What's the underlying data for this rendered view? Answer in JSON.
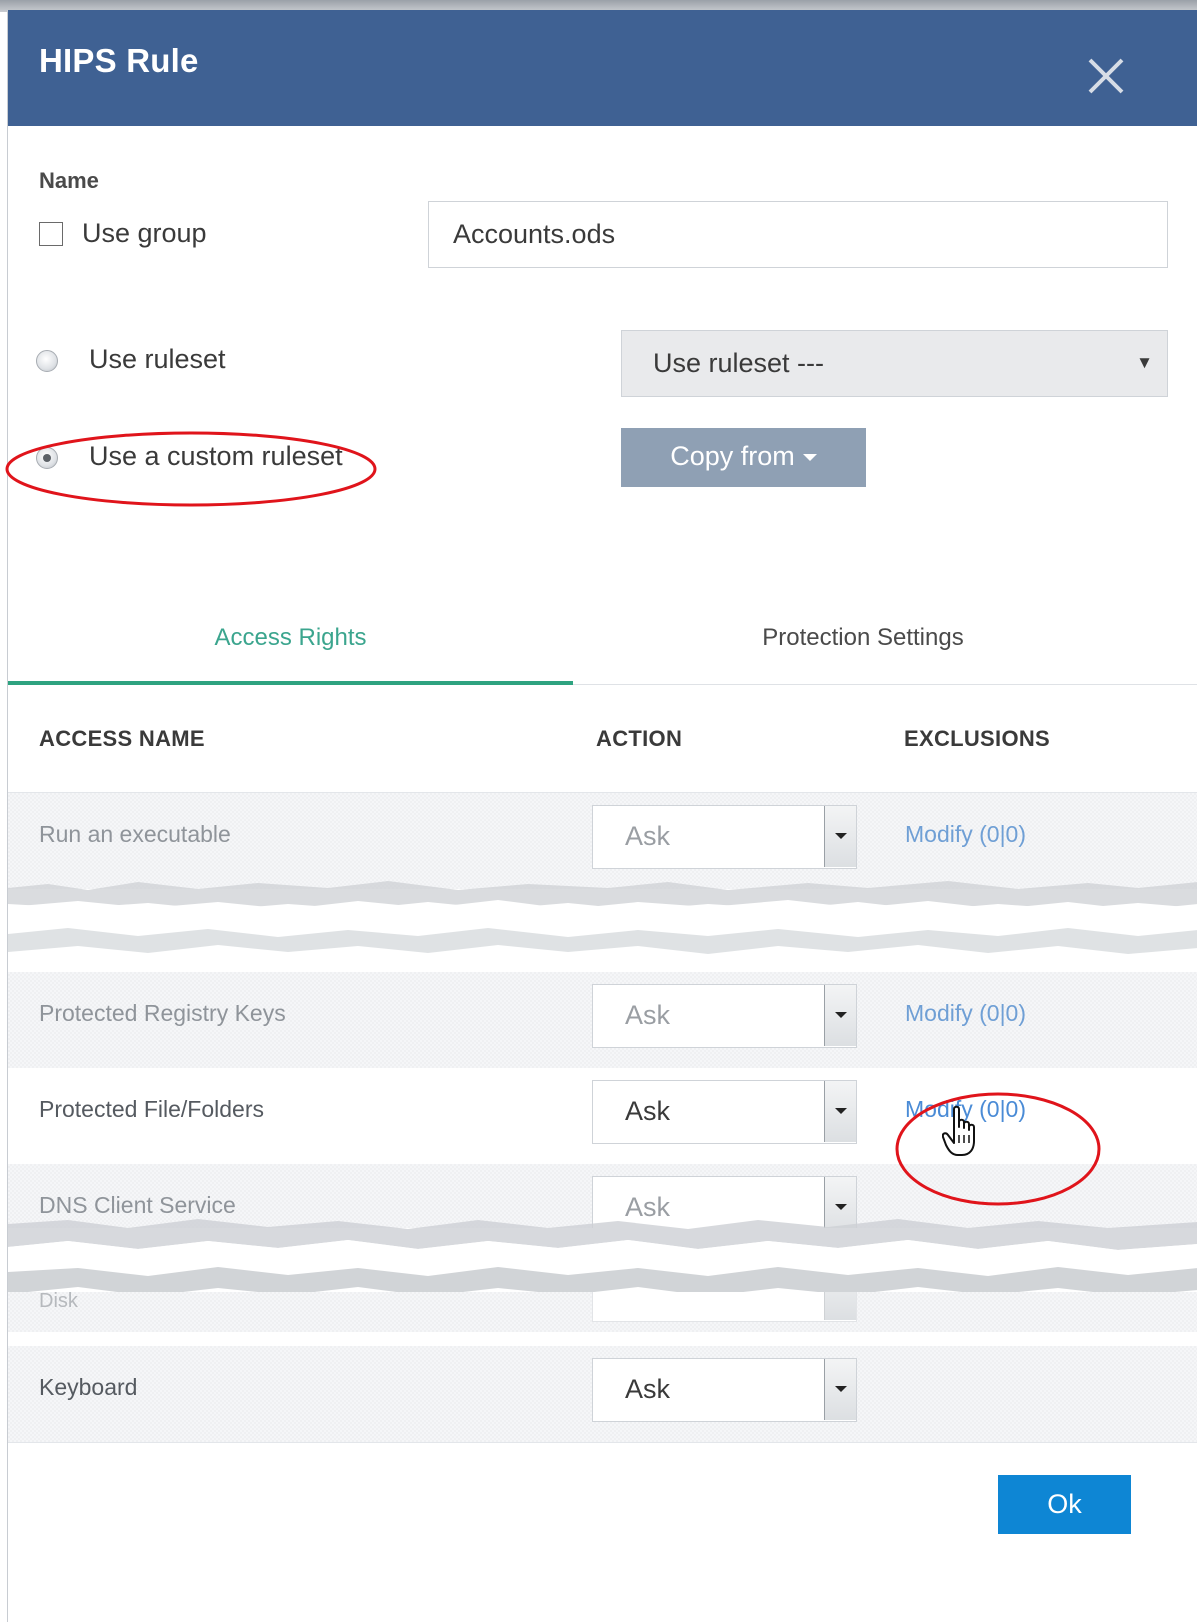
{
  "dialog": {
    "title": "HIPS Rule",
    "close_icon": "close-icon"
  },
  "form": {
    "name_label": "Name",
    "use_group_label": "Use group",
    "use_group_checked": false,
    "name_value": "Accounts.ods",
    "use_ruleset_label": "Use ruleset",
    "use_custom_ruleset_label": "Use a custom ruleset",
    "selected_mode": "custom",
    "ruleset_select_value": "Use ruleset ---",
    "ruleset_select_arrow": "▼",
    "copy_from_label": "Copy from"
  },
  "tabs": [
    {
      "label": "Access Rights",
      "active": true
    },
    {
      "label": "Protection Settings",
      "active": false
    }
  ],
  "table": {
    "headers": {
      "access_name": "ACCESS NAME",
      "action": "ACTION",
      "exclusions": "EXCLUSIONS"
    },
    "rows": [
      {
        "name": "Run an executable",
        "action": "Ask",
        "exclusions": "Modify (0|0)"
      },
      {
        "name": "Protected Registry Keys",
        "action": "Ask",
        "exclusions": "Modify (0|0)"
      },
      {
        "name": "Protected File/Folders",
        "action": "Ask",
        "exclusions": "Modify (0|0)"
      },
      {
        "name": "DNS Client Service",
        "action": "Ask",
        "exclusions": ""
      },
      {
        "name": "Disk",
        "action": "",
        "exclusions": ""
      },
      {
        "name": "Keyboard",
        "action": "Ask",
        "exclusions": ""
      }
    ]
  },
  "footer": {
    "ok_label": "Ok"
  },
  "colors": {
    "titlebar": "#3f6193",
    "tab_active": "#2ea380",
    "link": "#4a8bd6",
    "ok_button": "#0e86d4",
    "copy_button": "#8fa0b4",
    "annotation": "#e0141b"
  }
}
